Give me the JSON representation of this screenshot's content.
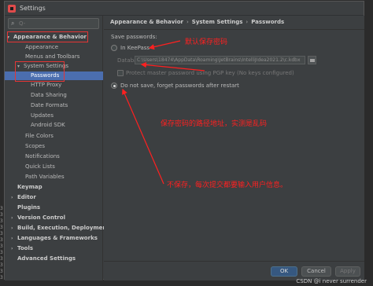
{
  "window": {
    "title": "Settings"
  },
  "gutter": [
    "3",
    "3",
    "3",
    "3",
    "3",
    "3",
    "3",
    "3",
    "3",
    "3",
    "3",
    "3"
  ],
  "sidebar": {
    "search_placeholder": "Q-",
    "items": [
      {
        "label": "Appearance & Behavior",
        "arrow": "▾"
      },
      {
        "label": "Appearance"
      },
      {
        "label": "Menus and Toolbars"
      },
      {
        "label": "System Settings",
        "arrow": "▾"
      },
      {
        "label": "Passwords"
      },
      {
        "label": "HTTP Proxy"
      },
      {
        "label": "Data Sharing"
      },
      {
        "label": "Date Formats"
      },
      {
        "label": "Updates"
      },
      {
        "label": "Android SDK"
      },
      {
        "label": "File Colors"
      },
      {
        "label": "Scopes"
      },
      {
        "label": "Notifications"
      },
      {
        "label": "Quick Lists"
      },
      {
        "label": "Path Variables"
      },
      {
        "label": "Keymap"
      },
      {
        "label": "Editor",
        "arrow": "›"
      },
      {
        "label": "Plugins"
      },
      {
        "label": "Version Control",
        "arrow": "›"
      },
      {
        "label": "Build, Execution, Deployment",
        "arrow": "›"
      },
      {
        "label": "Languages & Frameworks",
        "arrow": "›"
      },
      {
        "label": "Tools",
        "arrow": "›"
      },
      {
        "label": "Advanced Settings"
      }
    ]
  },
  "content": {
    "breadcrumb": [
      "Appearance & Behavior",
      "System Settings",
      "Passwords"
    ],
    "save_label": "Save passwords:",
    "keepass_label": "In KeePass",
    "database_label": "Database:",
    "database_path": "C:\\Users\\18474\\AppData\\Roaming\\JetBrains\\IntelliJIdea2021.2\\c.kdbx",
    "pgp_label": "Protect master password using PGP key (No keys configured)",
    "donotsave_label": "Do not save, forget passwords after restart"
  },
  "annotations": {
    "default": "默认保存密码",
    "path": "保存密码的路径地址，实测是乱码",
    "nosave": "不保存，每次提交都要输入用户信息。"
  },
  "footer": {
    "ok": "OK",
    "cancel": "Cancel",
    "apply": "Apply"
  },
  "watermark": "CSDN @i never surrender",
  "colors": {
    "selection": "#4b6eaf",
    "annotation": "#ff2020",
    "highlight_box": "#e53535"
  }
}
